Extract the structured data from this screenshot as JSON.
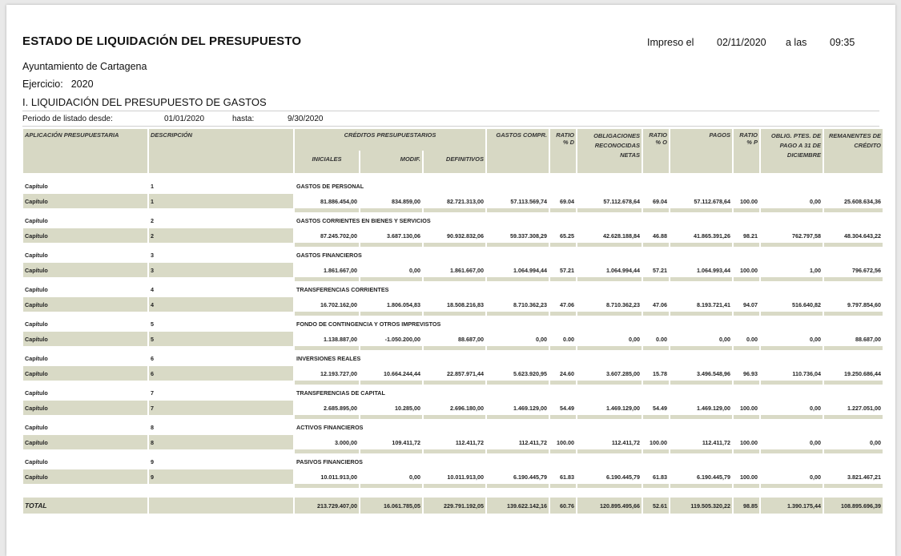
{
  "header": {
    "title": "ESTADO DE LIQUIDACIÓN DEL PRESUPUESTO",
    "printed_label": "Impreso el",
    "printed_date": "02/11/2020",
    "time_label": "a las",
    "printed_time": "09:35",
    "entity": "Ayuntamiento de Cartagena",
    "exercise_label": "Ejercicio:",
    "exercise_year": "2020",
    "section": "I. LIQUIDACIÓN DEL PRESUPUESTO DE GASTOS",
    "period_label": "Periodo de listado desde:",
    "period_from": "01/01/2020",
    "period_to_label": "hasta:",
    "period_to": "9/30/2020"
  },
  "columns": {
    "aplicacion": "APLICACIÓN PRESUPUESTARIA",
    "descripcion": "DESCRIPCIÓN",
    "creditos": "CRÉDITOS PRESUPUESTARIOS",
    "iniciales": "INICIALES",
    "modif": "MODIF.",
    "definitivos": "DEFINITIVOS",
    "gastos": "GASTOS COMPR.",
    "ratio_d": "RATIO % D",
    "obligaciones": "OBLIGACIONES RECONOCIDAS NETAS",
    "ratio_o": "RATIO % O",
    "pagos": "PAGOS",
    "ratio_p": "RATIO % P",
    "oblig_ptes": "OBLIG. PTES. DE PAGO A 31 DE DICIEMBRE",
    "remanentes": "REMANENTES DE CRÉDITO"
  },
  "chapters": [
    {
      "label": "Capítulo",
      "num": "1",
      "name": "GASTOS DE PERSONAL",
      "iniciales": "81.886.454,00",
      "modif": "834.859,00",
      "definitivos": "82.721.313,00",
      "gastos": "57.113.569,74",
      "ratio_d": "69.04",
      "obligaciones": "57.112.678,64",
      "ratio_o": "69.04",
      "pagos": "57.112.678,64",
      "ratio_p": "100.00",
      "ptes": "0,00",
      "remanentes": "25.608.634,36"
    },
    {
      "label": "Capítulo",
      "num": "2",
      "name": "GASTOS CORRIENTES EN BIENES Y SERVICIOS",
      "iniciales": "87.245.702,00",
      "modif": "3.687.130,06",
      "definitivos": "90.932.832,06",
      "gastos": "59.337.308,29",
      "ratio_d": "65.25",
      "obligaciones": "42.628.188,84",
      "ratio_o": "46.88",
      "pagos": "41.865.391,26",
      "ratio_p": "98.21",
      "ptes": "762.797,58",
      "remanentes": "48.304.643,22"
    },
    {
      "label": "Capítulo",
      "num": "3",
      "name": "GASTOS FINANCIEROS",
      "iniciales": "1.861.667,00",
      "modif": "0,00",
      "definitivos": "1.861.667,00",
      "gastos": "1.064.994,44",
      "ratio_d": "57.21",
      "obligaciones": "1.064.994,44",
      "ratio_o": "57.21",
      "pagos": "1.064.993,44",
      "ratio_p": "100.00",
      "ptes": "1,00",
      "remanentes": "796.672,56"
    },
    {
      "label": "Capítulo",
      "num": "4",
      "name": "TRANSFERENCIAS CORRIENTES",
      "iniciales": "16.702.162,00",
      "modif": "1.806.054,83",
      "definitivos": "18.508.216,83",
      "gastos": "8.710.362,23",
      "ratio_d": "47.06",
      "obligaciones": "8.710.362,23",
      "ratio_o": "47.06",
      "pagos": "8.193.721,41",
      "ratio_p": "94.07",
      "ptes": "516.640,82",
      "remanentes": "9.797.854,60"
    },
    {
      "label": "Capítulo",
      "num": "5",
      "name": "FONDO DE CONTINGENCIA Y OTROS IMPREVISTOS",
      "iniciales": "1.138.887,00",
      "modif": "-1.050.200,00",
      "definitivos": "88.687,00",
      "gastos": "0,00",
      "ratio_d": "0.00",
      "obligaciones": "0,00",
      "ratio_o": "0.00",
      "pagos": "0,00",
      "ratio_p": "0.00",
      "ptes": "0,00",
      "remanentes": "88.687,00"
    },
    {
      "label": "Capítulo",
      "num": "6",
      "name": "INVERSIONES REALES",
      "iniciales": "12.193.727,00",
      "modif": "10.664.244,44",
      "definitivos": "22.857.971,44",
      "gastos": "5.623.920,95",
      "ratio_d": "24.60",
      "obligaciones": "3.607.285,00",
      "ratio_o": "15.78",
      "pagos": "3.496.548,96",
      "ratio_p": "96.93",
      "ptes": "110.736,04",
      "remanentes": "19.250.686,44"
    },
    {
      "label": "Capítulo",
      "num": "7",
      "name": "TRANSFERENCIAS DE CAPITAL",
      "iniciales": "2.685.895,00",
      "modif": "10.285,00",
      "definitivos": "2.696.180,00",
      "gastos": "1.469.129,00",
      "ratio_d": "54.49",
      "obligaciones": "1.469.129,00",
      "ratio_o": "54.49",
      "pagos": "1.469.129,00",
      "ratio_p": "100.00",
      "ptes": "0,00",
      "remanentes": "1.227.051,00"
    },
    {
      "label": "Capítulo",
      "num": "8",
      "name": "ACTIVOS FINANCIEROS",
      "iniciales": "3.000,00",
      "modif": "109.411,72",
      "definitivos": "112.411,72",
      "gastos": "112.411,72",
      "ratio_d": "100.00",
      "obligaciones": "112.411,72",
      "ratio_o": "100.00",
      "pagos": "112.411,72",
      "ratio_p": "100.00",
      "ptes": "0,00",
      "remanentes": "0,00"
    },
    {
      "label": "Capítulo",
      "num": "9",
      "name": "PASIVOS FINANCIEROS",
      "iniciales": "10.011.913,00",
      "modif": "0,00",
      "definitivos": "10.011.913,00",
      "gastos": "6.190.445,79",
      "ratio_d": "61.83",
      "obligaciones": "6.190.445,79",
      "ratio_o": "61.83",
      "pagos": "6.190.445,79",
      "ratio_p": "100.00",
      "ptes": "0,00",
      "remanentes": "3.821.467,21"
    }
  ],
  "total": {
    "label": "TOTAL",
    "iniciales": "213.729.407,00",
    "modif": "16.061.785,05",
    "definitivos": "229.791.192,05",
    "gastos": "139.622.142,16",
    "ratio_d": "60.76",
    "obligaciones": "120.895.495,66",
    "ratio_o": "52.61",
    "pagos": "119.505.320,22",
    "ratio_p": "98.85",
    "ptes": "1.390.175,44",
    "remanentes": "108.895.696,39"
  }
}
